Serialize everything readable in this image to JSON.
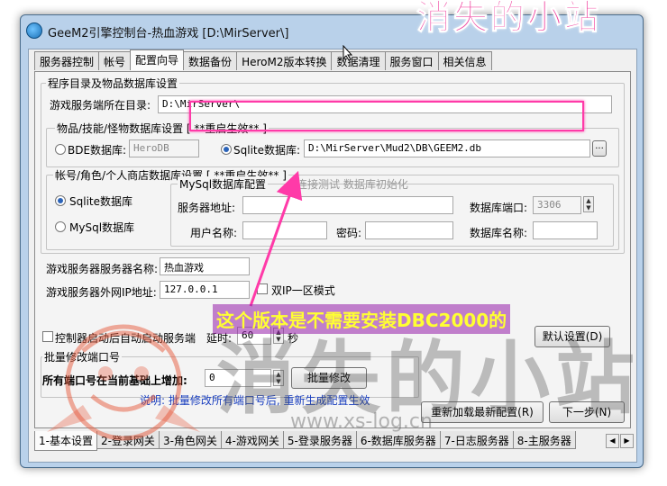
{
  "window": {
    "title": "GeeM2引擎控制台-热血游戏 [D:\\MirServer\\]"
  },
  "brand_text": "消失的小站",
  "top_tabs": [
    "服务器控制",
    "帐号",
    "配置向导",
    "数据备份",
    "HeroM2版本转换",
    "数据清理",
    "服务窗口",
    "相关信息"
  ],
  "active_top_tab": 2,
  "config": {
    "section_title": "程序目录及物品数据库设置",
    "dir_label": "游戏服务端所在目录:",
    "dir_value": "D:\\MirServer\\",
    "item_db_title": "物品/技能/怪物数据库设置 [ **重启生效** ]",
    "bde_label": "BDE数据库:",
    "bde_value": "HeroDB",
    "sqlite_label": "Sqlite数据库:",
    "sqlite_path": "D:\\MirServer\\Mud2\\DB\\GEEM2.db",
    "browse_label": "...",
    "account_db_title": "帐号/角色/个人商店数据库设置  [ **重启生效** ]",
    "sqlite_opt": "Sqlite数据库",
    "mysql_opt": "MySql数据库",
    "mysql_title": "MySql数据库配置",
    "mysql_links": "连接测试  数据库初始化",
    "server_addr_label": "服务器地址:",
    "port_label": "数据库端口:",
    "port_value": "3306",
    "username_label": "用户名称:",
    "password_label": "密码:",
    "dbname_label": "数据库名称:",
    "server_name_label": "游戏服务器服务器名称:",
    "server_name_value": "热血游戏",
    "ip_label": "游戏服务器外网IP地址:",
    "ip_value": "127.0.0.1",
    "dual_ip_label": "双IP一区模式",
    "autostart_label": "控制器启动后自动启动服务端",
    "delay_label": "延时:",
    "delay_value": "60",
    "delay_unit": "秒",
    "default_btn": "默认设置(D)",
    "port_batch_title": "批量修改端口号",
    "port_add_label": "所有端口号在当前基础上增加:",
    "port_add_value": "0",
    "batch_btn": "批量修改",
    "note": "说明: 批量修改所有端口号后, 重新生成配置生效",
    "reload_btn": "重新加载最新配置(R)",
    "next_btn": "下一步(N)"
  },
  "bottom_tabs": [
    "1-基本设置",
    "2-登录网关",
    "3-角色网关",
    "4-游戏网关",
    "5-登录服务器",
    "6-数据库服务器",
    "7-日志服务器",
    "8-主服务器"
  ],
  "annotation": "这个版本是不需要安装DBC2000的",
  "watermark": {
    "text": "消失的小站",
    "url": "www.xs-log.cn"
  },
  "colors": {
    "highlight": "#ff3aa8",
    "annotation_text": "#ffff33",
    "note_text": "#1a3fbf"
  }
}
